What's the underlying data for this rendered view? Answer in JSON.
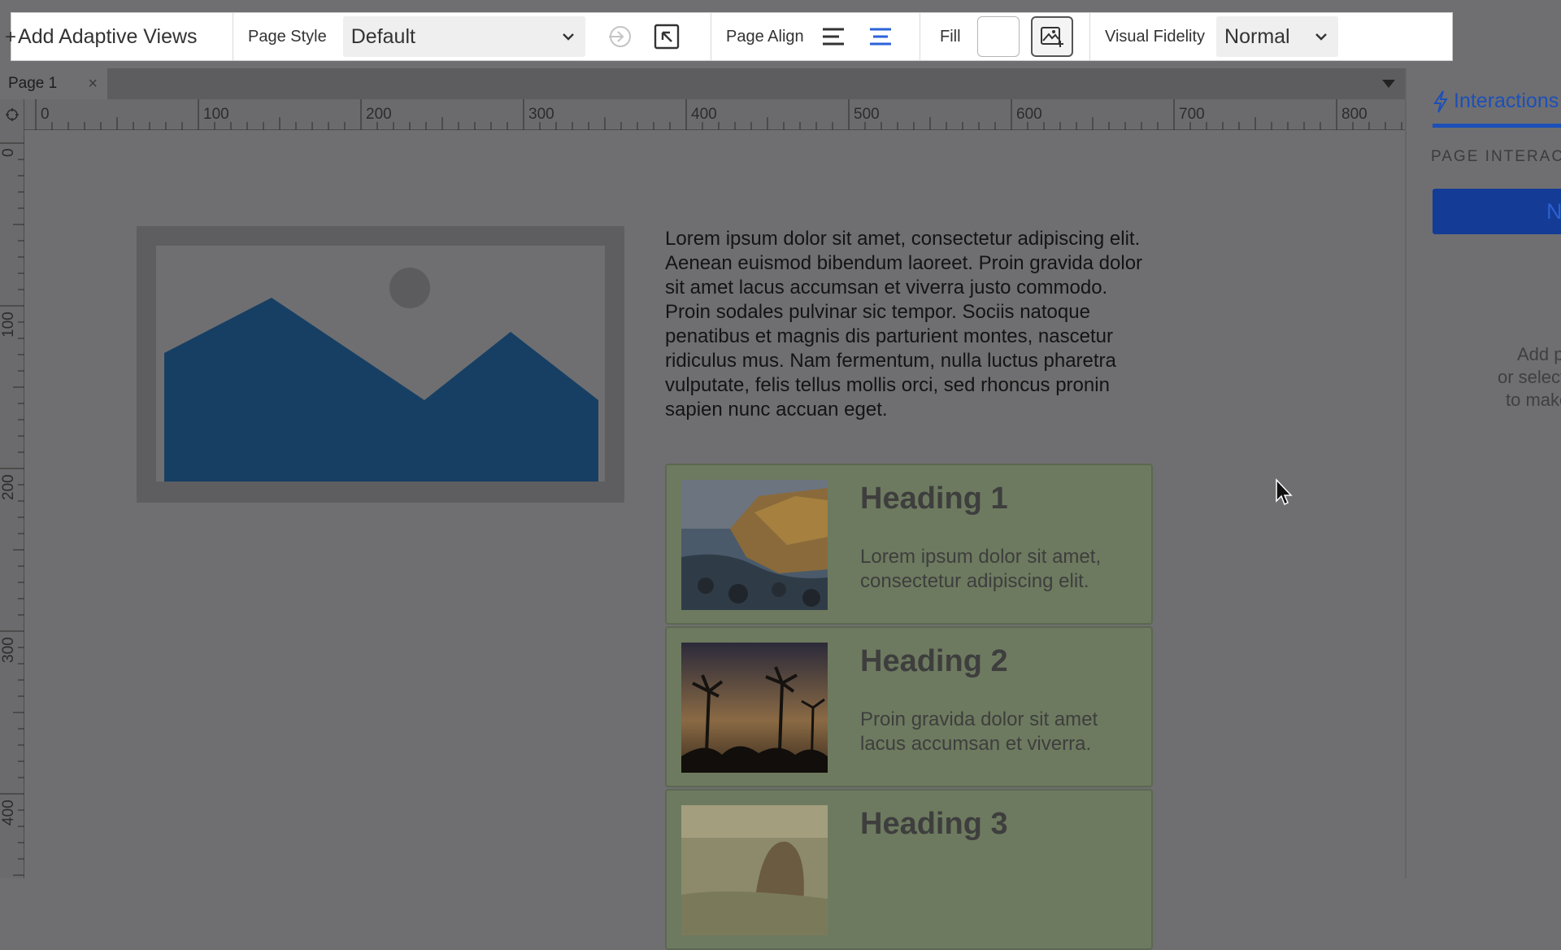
{
  "toolbar": {
    "add_adaptive_views": "Add Adaptive Views",
    "page_style_label": "Page Style",
    "page_style_value": "Default",
    "page_align_label": "Page Align",
    "fill_label": "Fill",
    "visual_fidelity_label": "Visual Fidelity",
    "visual_fidelity_value": "Normal"
  },
  "tabs": [
    {
      "label": "Page 1",
      "close": "×"
    }
  ],
  "ruler": {
    "top_labels": [
      "0",
      "100",
      "200",
      "300",
      "400",
      "500",
      "600",
      "700",
      "800"
    ],
    "left_labels": [
      "0",
      "100",
      "200",
      "300",
      "400"
    ]
  },
  "canvas": {
    "paragraph": "Lorem ipsum dolor sit amet, consectetur adipiscing elit. Aenean euismod bibendum laoreet. Proin gravida dolor sit amet lacus accumsan et viverra justo commodo. Proin sodales pulvinar sic tempor. Sociis natoque penatibus et magnis dis parturient montes, nascetur ridiculus mus. Nam fermentum, nulla luctus pharetra vulputate, felis tellus mollis orci, sed rhoncus pronin sapien nunc accuan eget.",
    "cards": [
      {
        "heading": "Heading 1",
        "text": "Lorem ipsum dolor sit amet, consectetur adipiscing elit."
      },
      {
        "heading": "Heading 2",
        "text": "Proin gravida dolor sit amet lacus accumsan et viverra."
      },
      {
        "heading": "Heading 3",
        "text": ""
      }
    ]
  },
  "right_panel": {
    "tab_label": "Interactions",
    "section_label": "PAGE INTERAC",
    "button_label": "Ne",
    "hint_lines": [
      "Add pag",
      "or select a",
      "to make"
    ]
  },
  "colors": {
    "accent": "#1d4fb8",
    "align_active": "#2b63d9"
  }
}
